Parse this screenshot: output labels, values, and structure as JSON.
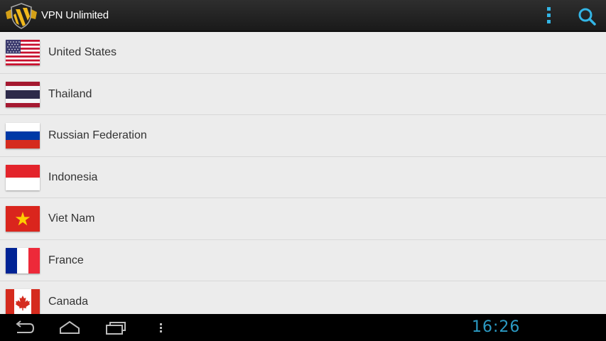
{
  "app": {
    "title": "VPN Unlimited",
    "icon": "shield-logo-icon"
  },
  "actionbar": {
    "overflow_icon": "overflow-menu-icon",
    "search_icon": "search-icon",
    "accent_color": "#33b5e5"
  },
  "countries": [
    {
      "name": "United States",
      "flag": "us"
    },
    {
      "name": "Thailand",
      "flag": "th"
    },
    {
      "name": "Russian Federation",
      "flag": "ru"
    },
    {
      "name": "Indonesia",
      "flag": "id"
    },
    {
      "name": "Viet Nam",
      "flag": "vn"
    },
    {
      "name": "France",
      "flag": "fr"
    },
    {
      "name": "Canada",
      "flag": "ca"
    }
  ],
  "navbar": {
    "buttons": [
      "back-icon",
      "home-icon",
      "recent-apps-icon",
      "menu-icon"
    ],
    "clock": "16:26"
  }
}
